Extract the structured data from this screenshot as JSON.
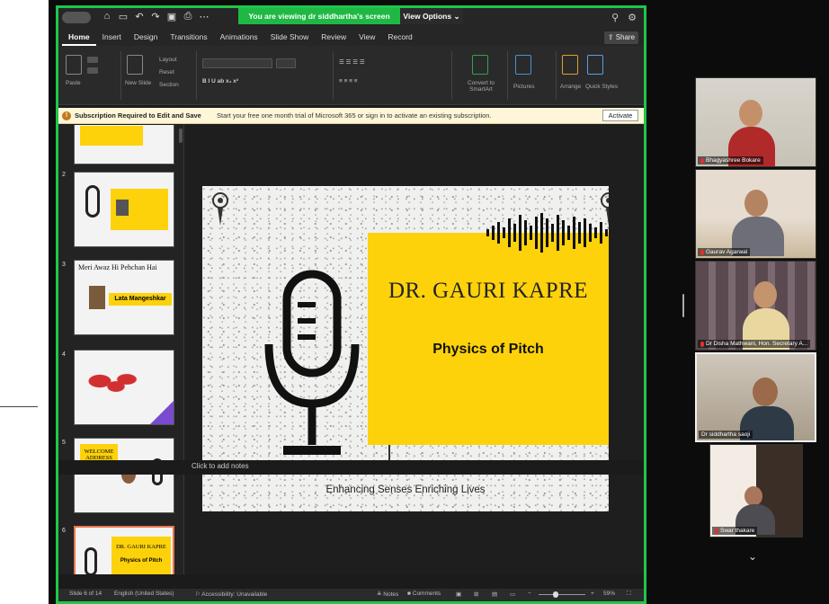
{
  "title_bar": {
    "viewing_banner": "You are viewing dr siddhartha's screen",
    "view_options": "View Options"
  },
  "ribbon": {
    "tabs": [
      "Home",
      "Insert",
      "Design",
      "Transitions",
      "Animations",
      "Slide Show",
      "Review",
      "View",
      "Record"
    ],
    "share": "Share",
    "groups": [
      "Paste",
      "New Slide",
      "Layout",
      "Reset",
      "Section",
      "Convert to SmartArt",
      "Pictures",
      "Arrange",
      "Quick Styles"
    ]
  },
  "notification": {
    "title": "Subscription Required to Edit and Save",
    "text": "Start your free one month trial of Microsoft 365 or sign in to activate an existing subscription.",
    "button": "Activate"
  },
  "thumbnails": [
    {
      "num": "2",
      "text": ""
    },
    {
      "num": "3",
      "text": "Meri Awaz Hi Pehchan Hai",
      "label": "Lata Mangeshkar"
    },
    {
      "num": "4",
      "text": ""
    },
    {
      "num": "5",
      "text": "WELCOME ADDRESS"
    },
    {
      "num": "6",
      "text": "DR. GAURI KAPRE",
      "sub": "Physics of Pitch"
    }
  ],
  "slide": {
    "title": "DR. GAURI KAPRE",
    "subtitle": "Physics of Pitch",
    "tagline": "Enhancing Senses Enriching Lives"
  },
  "notes_placeholder": "Click to add notes",
  "status_bar": {
    "slide_count": "Slide 6 of 14",
    "language": "English (United States)",
    "accessibility": "Accessibility: Unavailable",
    "notes": "Notes",
    "comments": "Comments",
    "zoom": "59%"
  },
  "participants": [
    {
      "name": "Bhagyashree Bokare"
    },
    {
      "name": "Gaurav Agarwal"
    },
    {
      "name": "Dr Disha Mathwani, Hon. Secretary A..."
    },
    {
      "name": "Dr siddhartha saoji"
    },
    {
      "name": "Swar thakare"
    }
  ],
  "colors": {
    "accent_green": "#1fc74a",
    "slide_yellow": "#fdd20b",
    "active_thumb": "#e8744c"
  }
}
